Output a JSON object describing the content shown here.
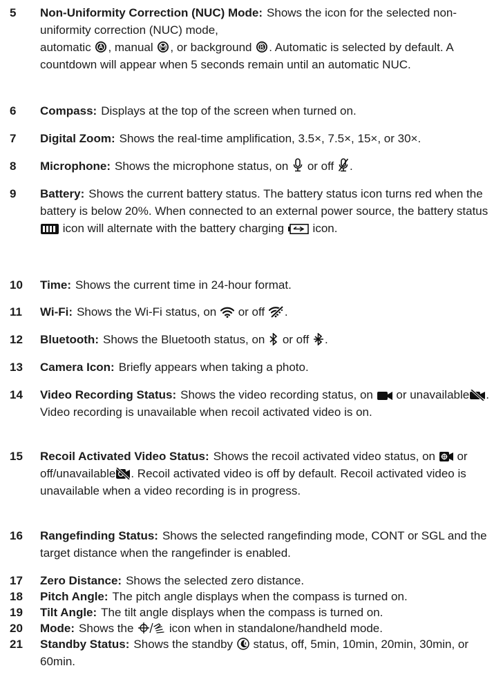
{
  "colors": {
    "text": "#1c1c1c",
    "icon": "#111111",
    "background": "#ffffff"
  },
  "items": [
    {
      "num": "5",
      "term": "Non-Uniformity Correction (NUC) Mode:",
      "t1": "Shows the icon for the selected non-uniformity correction (NUC) mode,",
      "t2": "automatic",
      "t3": ", manual",
      "t4": ", or background",
      "t5": ". Automatic is selected by default. A countdown will appear when 5 seconds remain until an automatic NUC.",
      "icons": [
        "nuc-automatic-icon",
        "nuc-manual-icon",
        "nuc-background-icon"
      ]
    },
    {
      "num": "6",
      "term": "Compass:",
      "t1": "Displays at the top of the screen when turned on."
    },
    {
      "num": "7",
      "term": "Digital Zoom:",
      "t1": "Shows the real-time amplification, 3.5×, 7.5×, 15×, or 30×."
    },
    {
      "num": "8",
      "term": "Microphone:",
      "t1": "Shows the microphone status, on",
      "t2": "or off",
      "t3": ".",
      "icons": [
        "microphone-on-icon",
        "microphone-off-icon"
      ]
    },
    {
      "num": "9",
      "term": "Battery:",
      "t1": "Shows the current battery status. The battery status icon turns red when the battery is below 20%. When connected to an external power source, the battery status",
      "t2": "icon will alternate with the battery charging",
      "t3": "icon.",
      "icons": [
        "battery-full-icon",
        "battery-charging-icon"
      ]
    },
    {
      "num": "10",
      "term": "Time:",
      "t1": "Shows the current time in 24-hour format."
    },
    {
      "num": "11",
      "term": "Wi-Fi:",
      "t1": "Shows the Wi-Fi status, on",
      "t2": "or off",
      "t3": ".",
      "icons": [
        "wifi-on-icon",
        "wifi-off-icon"
      ]
    },
    {
      "num": "12",
      "term": "Bluetooth:",
      "t1": "Shows the Bluetooth status, on",
      "t2": "or off",
      "t3": ".",
      "icons": [
        "bluetooth-on-icon",
        "bluetooth-off-icon"
      ]
    },
    {
      "num": "13",
      "term": "Camera Icon:",
      "t1": "Briefly appears when taking a photo."
    },
    {
      "num": "14",
      "term": "Video Recording Status:",
      "t1": "Shows the video recording status, on",
      "t2": "or unavailable",
      "t3": ". Video recording is unavailable when recoil activated video is on.",
      "icons": [
        "video-camera-icon",
        "video-camera-off-icon"
      ]
    },
    {
      "num": "15",
      "term": "Recoil Activated Video Status:",
      "t1": "Shows the recoil activated video status, on",
      "t2": "or off/unavailable",
      "t3": ". Recoil activated video is off by default. Recoil activated video is unavailable when a video recording is in progress.",
      "icons": [
        "recoil-video-icon",
        "recoil-video-off-icon"
      ]
    },
    {
      "num": "16",
      "term": "Rangefinding Status:",
      "t1": "Shows the selected rangefinding mode, CONT or SGL and the target distance when the rangefinder is enabled."
    },
    {
      "num": "17",
      "term": "Zero Distance:",
      "t1": "Shows the selected zero distance."
    },
    {
      "num": "18",
      "term": "Pitch Angle:",
      "t1": "The pitch angle displays when the compass is turned on."
    },
    {
      "num": "19",
      "term": "Tilt Angle:",
      "t1": "The tilt angle displays when the compass is turned on."
    },
    {
      "num": "20",
      "term": "Mode:",
      "t1": "Shows the",
      "t2": "icon when in standalone/handheld mode.",
      "icons": [
        "standalone-handheld-mode-icon"
      ]
    },
    {
      "num": "21",
      "term": "Standby Status:",
      "t1": "Shows the standby",
      "t2": "status, off, 5min, 10min, 20min, 30min, or 60min.",
      "icons": [
        "standby-icon"
      ]
    }
  ]
}
